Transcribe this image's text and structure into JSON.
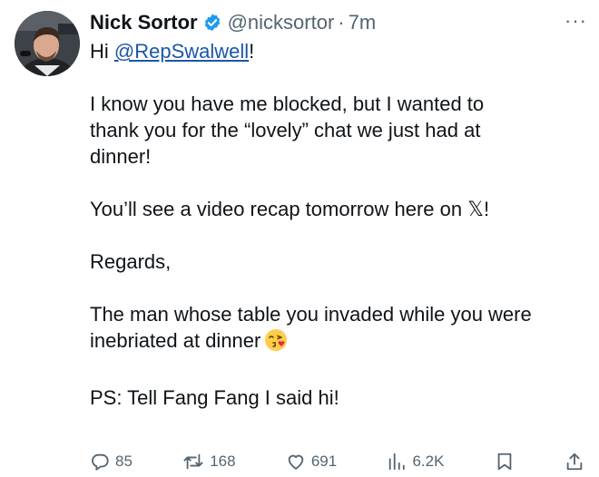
{
  "author": {
    "name": "Nick Sortor",
    "handle": "@nicksortor",
    "separator": "·",
    "time": "7m"
  },
  "more_label": "···",
  "tweet": {
    "line1_prefix": "Hi ",
    "mention": "@RepSwalwell",
    "line1_suffix": "!",
    "para2_l1": "I know you have me blocked, but I wanted to",
    "para2_l2": "thank you for the “lovely” chat we just had at",
    "para2_l3": "dinner!",
    "para3_prefix": "You’ll see a video recap tomorrow here on ",
    "para3_x": "𝕏",
    "para3_suffix": "!",
    "para4": "Regards,",
    "para5_l1": "The man whose table you invaded while you were",
    "para5_l2": "inebriated at dinner",
    "para6": "PS: Tell Fang Fang I said hi!"
  },
  "emoji": "face-blowing-a-kiss",
  "actions": {
    "replies": "85",
    "reposts": "168",
    "likes": "691",
    "views": "6.2K"
  },
  "icons": [
    "verified-badge-icon",
    "reply-icon",
    "repost-icon",
    "like-icon",
    "views-icon",
    "bookmark-icon",
    "share-icon"
  ],
  "colors": {
    "text": "#0f1419",
    "muted": "#536471",
    "verified": "#1d9bf0",
    "link": "#1a56a8"
  }
}
